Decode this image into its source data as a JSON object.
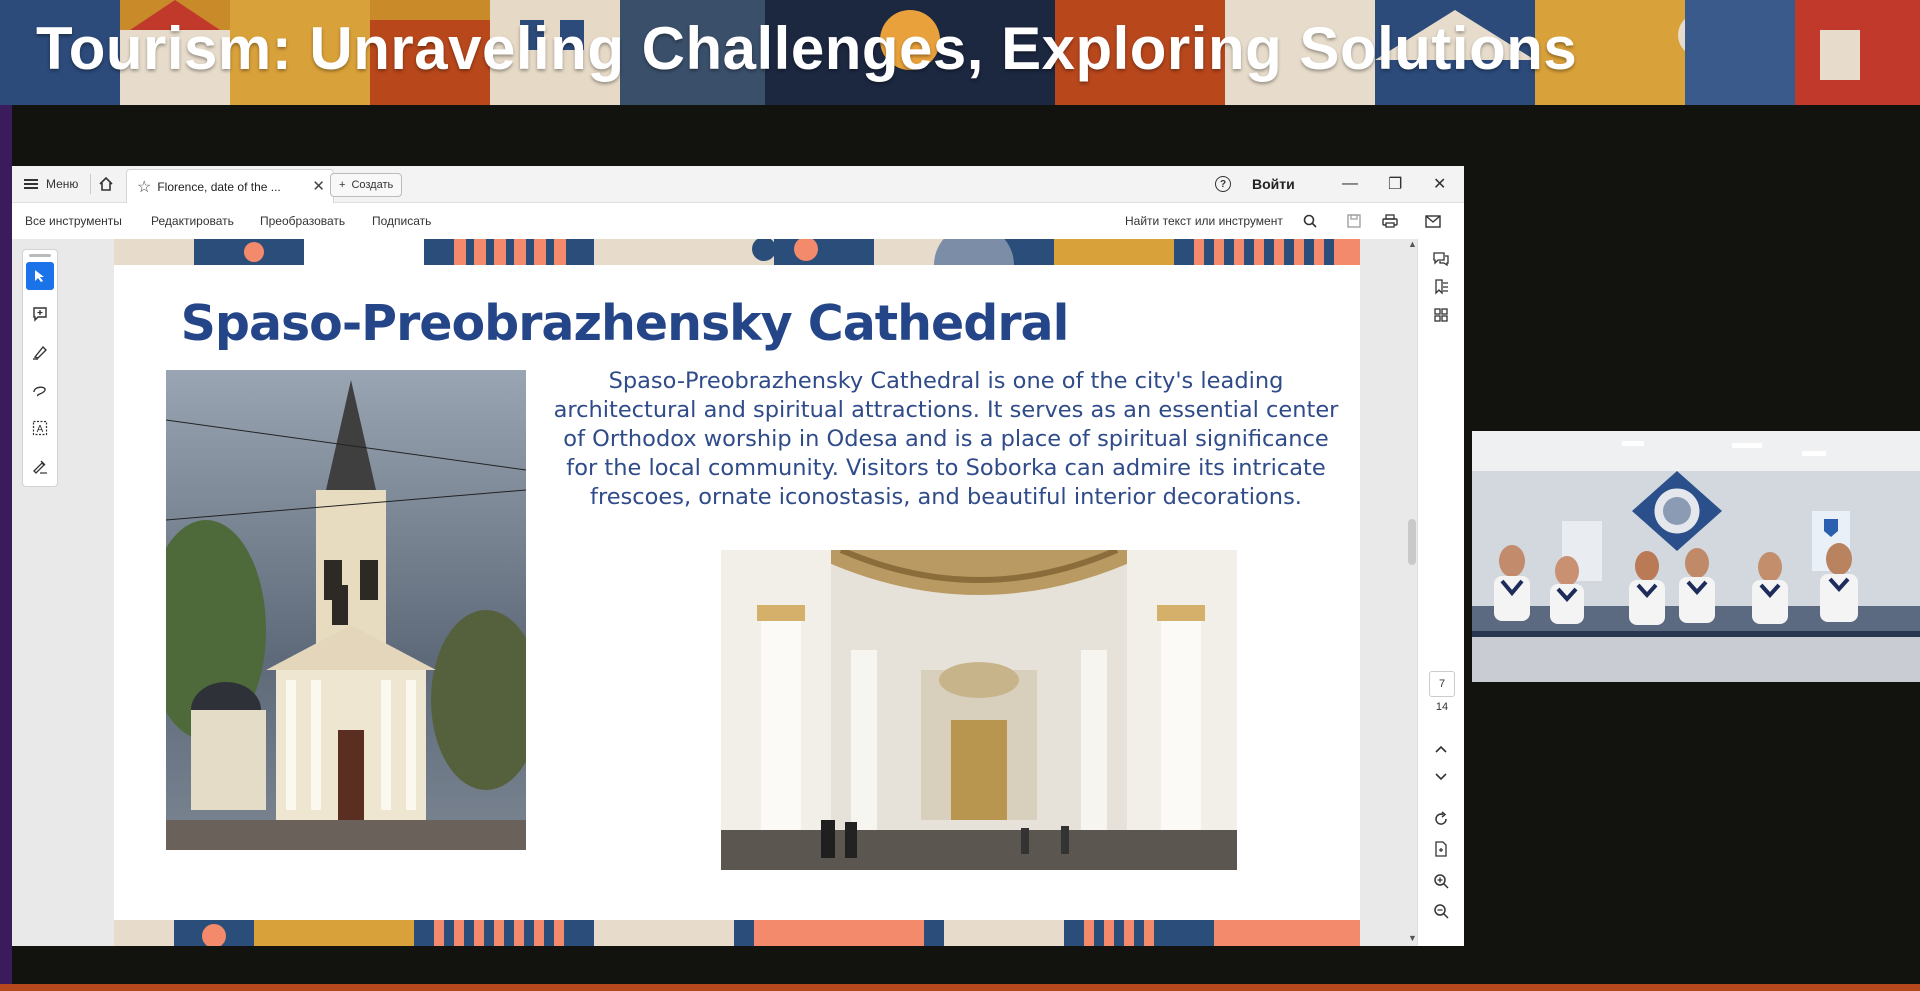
{
  "banner": {
    "title": "Tourism: Unraveling Challenges, Exploring Solutions"
  },
  "titlebar": {
    "menu_label": "Меню",
    "tab_title": "Florence, date of the ...",
    "create_label": "Создать",
    "login_label": "Войти",
    "icons": [
      "menu-icon",
      "home-icon",
      "star-icon",
      "close-tab-icon",
      "plus-icon",
      "help-icon",
      "minimize-icon",
      "restore-icon",
      "close-window-icon"
    ]
  },
  "toolbar": {
    "items": [
      "Все инструменты",
      "Редактировать",
      "Преобразовать",
      "Подписать"
    ],
    "search_label": "Найти текст или инструмент"
  },
  "slide": {
    "title": "Spaso-Preobrazhensky Cathedral",
    "text": "Spaso-Preobrazhensky Cathedral is one of the city's leading architectural and spiritual attractions. It serves as an essential center of Orthodox worship in Odesa and is a place of spiritual significance for the local community. Visitors to Soborka can admire its intricate frescoes, ornate iconostasis, and beautiful interior decorations."
  },
  "pager": {
    "current": "7",
    "total": "14"
  },
  "colors": {
    "title_blue": "#244588",
    "text_blue": "#2f4b89",
    "accent_blue": "#1a73e8",
    "banner_orange": "#c98b2a"
  }
}
